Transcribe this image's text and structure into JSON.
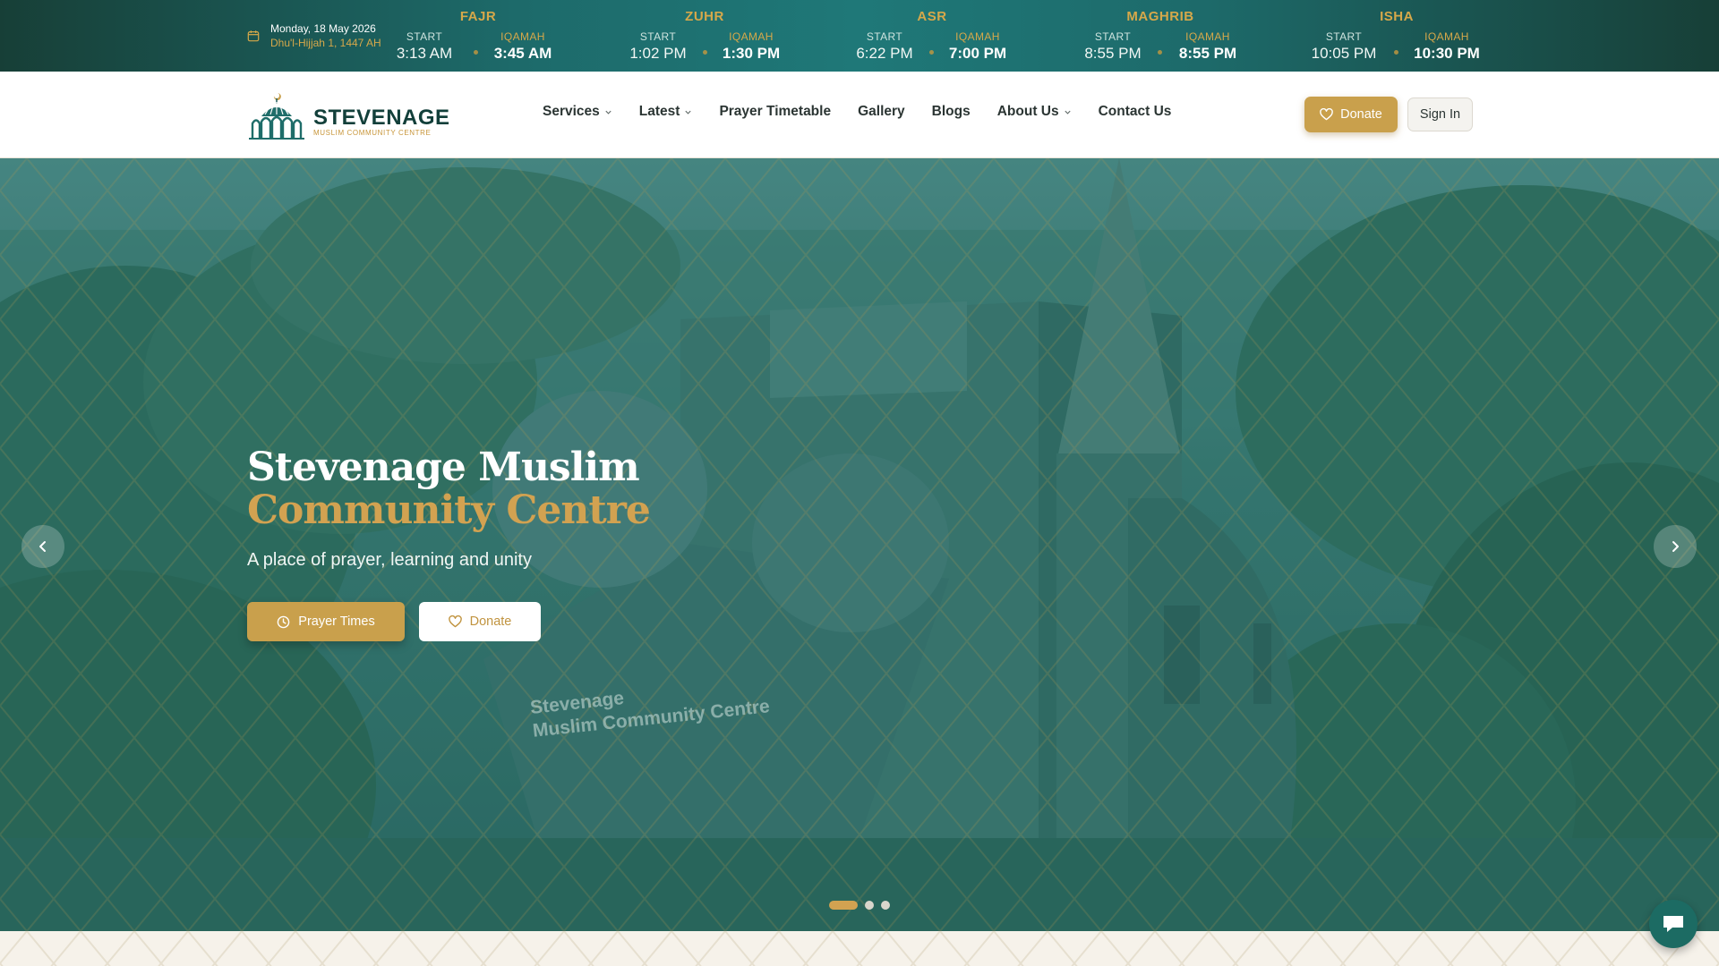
{
  "date": {
    "gregorian": "Monday, 18 May 2026",
    "hijri": "Dhu'l-Hijjah 1, 1447 AH"
  },
  "prayer_labels": {
    "start": "START",
    "iqamah": "IQAMAH"
  },
  "prayers": [
    {
      "name": "FAJR",
      "start": "3:13 AM",
      "iqamah": "3:45 AM"
    },
    {
      "name": "ZUHR",
      "start": "1:02 PM",
      "iqamah": "1:30 PM"
    },
    {
      "name": "ASR",
      "start": "6:22 PM",
      "iqamah": "7:00 PM"
    },
    {
      "name": "MAGHRIB",
      "start": "8:55 PM",
      "iqamah": "8:55 PM"
    },
    {
      "name": "ISHA",
      "start": "10:05 PM",
      "iqamah": "10:30 PM"
    }
  ],
  "logo": {
    "name": "STEVENAGE",
    "subtitle": "MUSLIM COMMUNITY CENTRE"
  },
  "nav": [
    {
      "label": "Services",
      "dropdown": true
    },
    {
      "label": "Latest",
      "dropdown": true
    },
    {
      "label": "Prayer Timetable",
      "dropdown": false
    },
    {
      "label": "Gallery",
      "dropdown": false
    },
    {
      "label": "Blogs",
      "dropdown": false
    },
    {
      "label": "About Us",
      "dropdown": true
    },
    {
      "label": "Contact Us",
      "dropdown": false
    }
  ],
  "header_actions": {
    "donate": "Donate",
    "signin": "Sign In"
  },
  "hero": {
    "title_line1": "Stevenage Muslim",
    "title_line2": "Community Centre",
    "subtitle": "A place of prayer, learning and unity",
    "btn_prayer": "Prayer Times",
    "btn_donate": "Donate",
    "building_sign": [
      "Stevenage",
      "Muslim Community Centre"
    ],
    "slides_total": 3,
    "slide_active": 1
  },
  "colors": {
    "gold": "#c9a04c",
    "teal_dark": "#173f37",
    "teal": "#1f7878",
    "hero_overlay": "#1d6f6a"
  },
  "icons": [
    "calendar-icon",
    "chevron-down-icon",
    "heart-icon",
    "clock-icon",
    "chevron-left-icon",
    "chevron-right-icon",
    "chat-icon"
  ]
}
